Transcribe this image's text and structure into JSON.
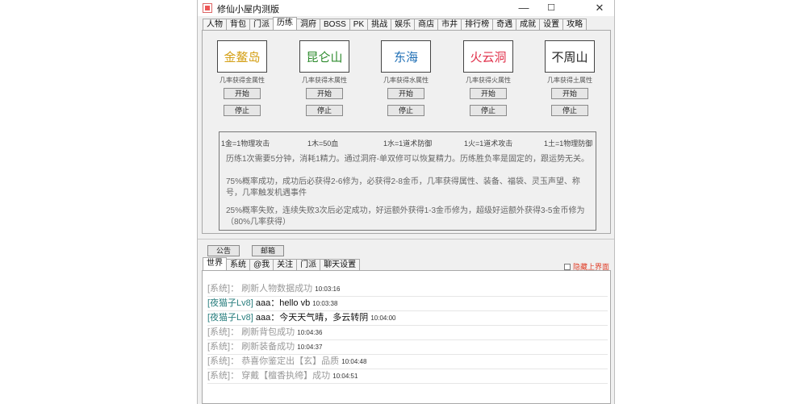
{
  "window": {
    "title": "修仙小屋内测版"
  },
  "titlebar_controls": {
    "minimize": "—",
    "maximize": "☐",
    "close": "✕"
  },
  "tabs": [
    "人物",
    "背包",
    "门派",
    "历练",
    "洞府",
    "BOSS",
    "PK",
    "挑战",
    "娱乐",
    "商店",
    "市井",
    "排行榜",
    "奇遇",
    "成就",
    "设置",
    "攻略"
  ],
  "active_tab": "历练",
  "places": [
    {
      "name": "金鳌岛",
      "color": "#d4a017",
      "desc": "几率获得金属性",
      "start": "开始",
      "stop": "停止"
    },
    {
      "name": "昆仑山",
      "color": "#2e8b2e",
      "desc": "几率获得木属性",
      "start": "开始",
      "stop": "停止"
    },
    {
      "name": "东海",
      "color": "#1f6fb5",
      "desc": "几率获得水属性",
      "start": "开始",
      "stop": "停止"
    },
    {
      "name": "火云洞",
      "color": "#e0304a",
      "desc": "几率获得火属性",
      "start": "开始",
      "stop": "停止"
    },
    {
      "name": "不周山",
      "color": "#222222",
      "desc": "几率获得土属性",
      "start": "开始",
      "stop": "停止"
    }
  ],
  "conversions": [
    "1金=1物理攻击",
    "1木=50血",
    "1水=1道术防御",
    "1火=1道术攻击",
    "1土=1物理防御"
  ],
  "info": [
    "历练1次需要5分钟，消耗1精力。通过洞府-单双修可以恢复精力。历练胜负率是固定的，跟运势无关。",
    "75%概率成功，成功后必获得2-6修为，必获得2-8金币，几率获得属性、装备、福袋、灵玉声望、称号，几率触发机遇事件",
    "25%概率失败，连续失败3次后必定成功，好运额外获得1-3金币修为，超级好运额外获得3-5金币修为（80%几率获得）"
  ],
  "buttons": {
    "announcement": "公告",
    "mail": "邮箱"
  },
  "chat_tabs": [
    "世界",
    "系统",
    "@我",
    "关注",
    "门派",
    "聊天设置"
  ],
  "active_chat_tab": "世界",
  "hide_option": "隐藏上界面",
  "messages": [
    {
      "sender": "[系统]",
      "text": "刷新人物数据成功",
      "time": "10:03:16",
      "kind": "system"
    },
    {
      "sender": "[夜猫子Lv8]",
      "user": "aaa",
      "text": "hello vb",
      "time": "10:03:38",
      "kind": "user"
    },
    {
      "sender": "[夜猫子Lv8]",
      "user": "aaa",
      "text": "今天天气晴，多云转阴",
      "time": "10:04:00",
      "kind": "user"
    },
    {
      "sender": "[系统]",
      "text": "刷新背包成功",
      "time": "10:04:36",
      "kind": "system"
    },
    {
      "sender": "[系统]",
      "text": "刷新装备成功",
      "time": "10:04:37",
      "kind": "system"
    },
    {
      "sender": "[系统]",
      "text": "恭喜你鉴定出【玄】品质",
      "time": "10:04:48",
      "kind": "system"
    },
    {
      "sender": "[系统]",
      "text": "穿戴【檀香执绔】成功",
      "time": "10:04:51",
      "kind": "system"
    }
  ]
}
